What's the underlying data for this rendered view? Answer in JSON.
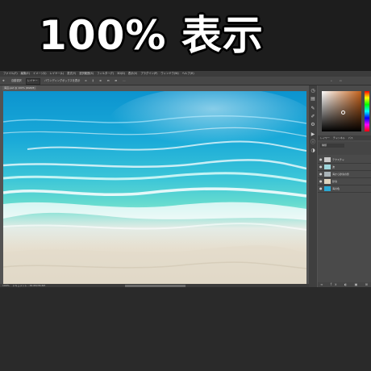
{
  "banner": {
    "title": "100% 表示"
  },
  "menubar": {
    "items": [
      "ファイル(F)",
      "編集(E)",
      "イメージ(I)",
      "レイヤー(L)",
      "書式(Y)",
      "選択範囲(S)",
      "フィルター(T)",
      "3D(D)",
      "表示(V)",
      "プラグイン(P)",
      "ウィンドウ(W)",
      "ヘルプ(H)"
    ]
  },
  "optionsbar": {
    "auto_select": "自動選択",
    "target": "レイヤー",
    "transform_controls": "バウンディングボックスを表示"
  },
  "document": {
    "tab_title": "海辺.psd @ 100% (RGB/8)"
  },
  "status": {
    "zoom": "100%",
    "doc_info": "ドキュメント : 36.6M/36.6M"
  },
  "layers_panel": {
    "tabs": [
      "レイヤー",
      "チャンネル",
      "パス"
    ],
    "kind_label": "種類",
    "layers": [
      {
        "name": "テクスチャ",
        "thumb": "#c9c9c9"
      },
      {
        "name": "波",
        "thumb": "#9fd6dc"
      },
      {
        "name": "海から砂浜の影",
        "thumb": "#aab4b8"
      },
      {
        "name": "砂浜",
        "thumb": "#ddd4bf"
      },
      {
        "name": "海の色",
        "thumb": "#2aa9d4"
      }
    ]
  },
  "colors": {
    "banner_bg": "#1d1d1d",
    "app_bg": "#535353",
    "sea_deep": "#17a7d4",
    "sand": "#e6dfcf"
  }
}
